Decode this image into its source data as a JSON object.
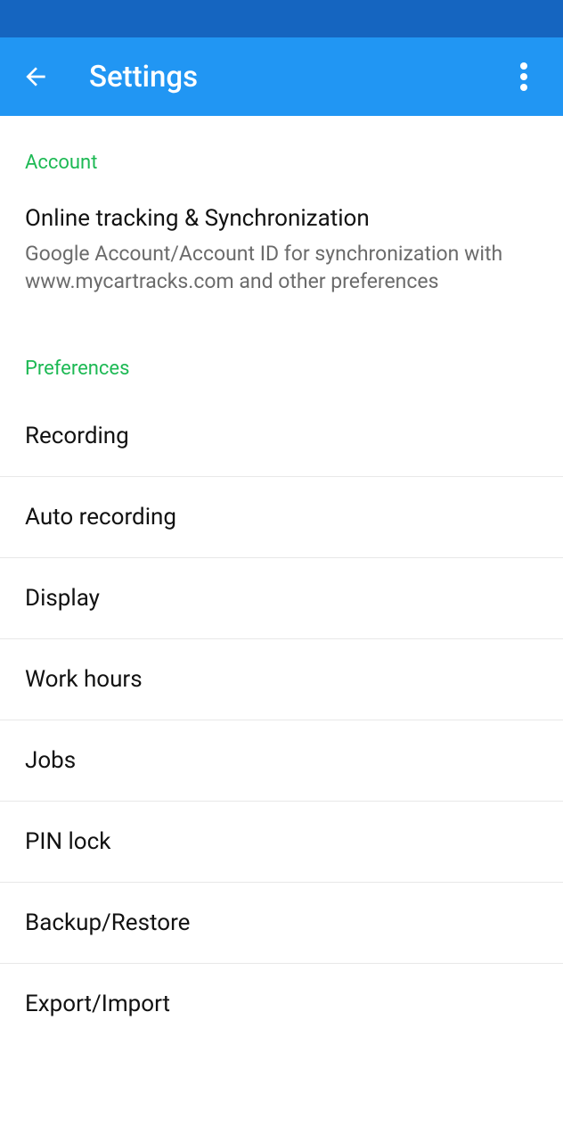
{
  "toolbar": {
    "title": "Settings"
  },
  "sections": {
    "account": {
      "header": "Account",
      "item": {
        "title": "Online tracking & Synchronization",
        "subtitle": "Google Account/Account ID for synchronization with www.mycartracks.com and other preferences"
      }
    },
    "preferences": {
      "header": "Preferences",
      "items": [
        "Recording",
        "Auto recording",
        "Display",
        "Work hours",
        "Jobs",
        "PIN lock",
        "Backup/Restore",
        "Export/Import"
      ]
    }
  }
}
